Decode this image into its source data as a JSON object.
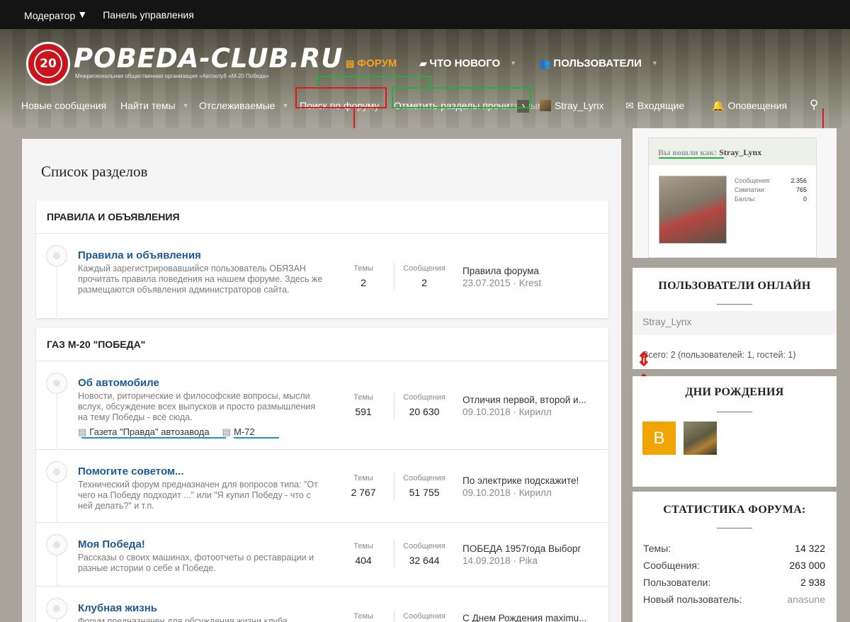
{
  "modbar": {
    "moderator": "Модератор",
    "control_panel": "Панель управления"
  },
  "brand": {
    "logo_text": "POBEDA-CLUB.RU",
    "logo_sub": "Межрегиональная общественная организация «Автоклуб «М-20 Победа»",
    "badge": "20",
    "accent": "#f5a01a"
  },
  "main_nav": {
    "forum": "ФОРУМ",
    "whats_new": "ЧТО НОВОГО",
    "users": "ПОЛЬЗОВАТЕЛИ"
  },
  "sub_nav": {
    "new_messages": "Новые сообщения",
    "find_threads": "Найти темы",
    "watched": "Отслеживаемые",
    "search_forum": "Поиск по форуму",
    "mark_read": "Отметить разделы прочи",
    "mark_read_faded": "танными",
    "chevron": "›",
    "user": "Stray_Lynx",
    "inbox": "Входящие",
    "alerts": "Оповещения"
  },
  "page": {
    "title": "Список разделов"
  },
  "categories": [
    {
      "name": "ПРАВИЛА И ОБЪЯВЛЕНИЯ",
      "forums": [
        {
          "title": "Правила и объявления",
          "desc": "Каждый зарегистрировавшийся пользователь ОБЯЗАН прочитать правила поведения на нашем форуме. Здесь же размещаются объявления администраторов сайта.",
          "threads_label": "Темы",
          "threads": "2",
          "messages_label": "Сообщения",
          "messages": "2",
          "last_title": "Правила форума",
          "last_meta": "23.07.2015 · Krest"
        }
      ]
    },
    {
      "name": "ГАЗ М-20 \"ПОБЕДА\"",
      "forums": [
        {
          "title": "Об автомобиле",
          "desc": "Новости, риторические и философские вопросы, мысли вслух, обсуждение всех выпусков и просто размышления на тему Победы - всё сюда.",
          "threads_label": "Темы",
          "threads": "591",
          "messages_label": "Сообщения",
          "messages": "20 630",
          "last_title": "Отличия первой, второй и...",
          "last_meta": "09.10.2018 · Кирилл",
          "subforums": [
            "Газета \"Правда\" автозавода",
            "М-72"
          ]
        },
        {
          "title": "Помогите советом...",
          "desc": "Технический форум предназначен для вопросов типа: \"От чего на Победу подходит ...\" или \"Я купил Победу - что с ней делать?\" и т.п.",
          "threads_label": "Темы",
          "threads": "2 767",
          "messages_label": "Сообщения",
          "messages": "51 755",
          "last_title": "По электрике подскажите!",
          "last_meta": "09.10.2018 · Кирилл"
        },
        {
          "title": "Моя Победа!",
          "desc": "Рассказы о своих машинах, фотоотчеты о реставрации и разные истории о себе и Победе.",
          "threads_label": "Темы",
          "threads": "404",
          "messages_label": "Сообщения",
          "messages": "32 644",
          "last_title": "ПОБЕДА 1957года Выборг",
          "last_meta": "14.09.2018 · Pika"
        },
        {
          "title": "Клубная жизнь",
          "desc": "Форум предназначен для обсуждения жизни клуба",
          "threads_label": "Темы",
          "threads": "",
          "messages_label": "Сообщения",
          "messages": "",
          "last_title": "С Днем Рождения maximu...",
          "last_meta": ""
        }
      ]
    }
  ],
  "sidebar": {
    "logged_in_label": "Вы вошли как:",
    "logged_in_user": "Stray_Lynx",
    "user_stats": [
      {
        "label": "Сообщения:",
        "value": "2.356"
      },
      {
        "label": "Симпатии:",
        "value": "765"
      },
      {
        "label": "Баллы:",
        "value": "0"
      }
    ],
    "online_title": "ПОЛЬЗОВАТЕЛИ ОНЛАЙН",
    "online_user": "Stray_Lynx",
    "online_total": "Всего: 2 (пользователей: 1, гостей: 1)",
    "birthdays_title": "ДНИ РОЖДЕНИЯ",
    "birthday_letter": "В",
    "forum_stats_title": "СТАТИСТИКА ФОРУМА:",
    "forum_stats": [
      {
        "label": "Темы:",
        "value": "14 322"
      },
      {
        "label": "Сообщения:",
        "value": "263 000"
      },
      {
        "label": "Пользователи:",
        "value": "2 938"
      },
      {
        "label": "Новый пользователь:",
        "value": "anasune"
      }
    ]
  },
  "icons": [
    "caret-down-icon",
    "forum-icon",
    "whats-new-icon",
    "users-icon",
    "envelope-icon",
    "bell-icon",
    "search-icon",
    "chat-icon"
  ]
}
